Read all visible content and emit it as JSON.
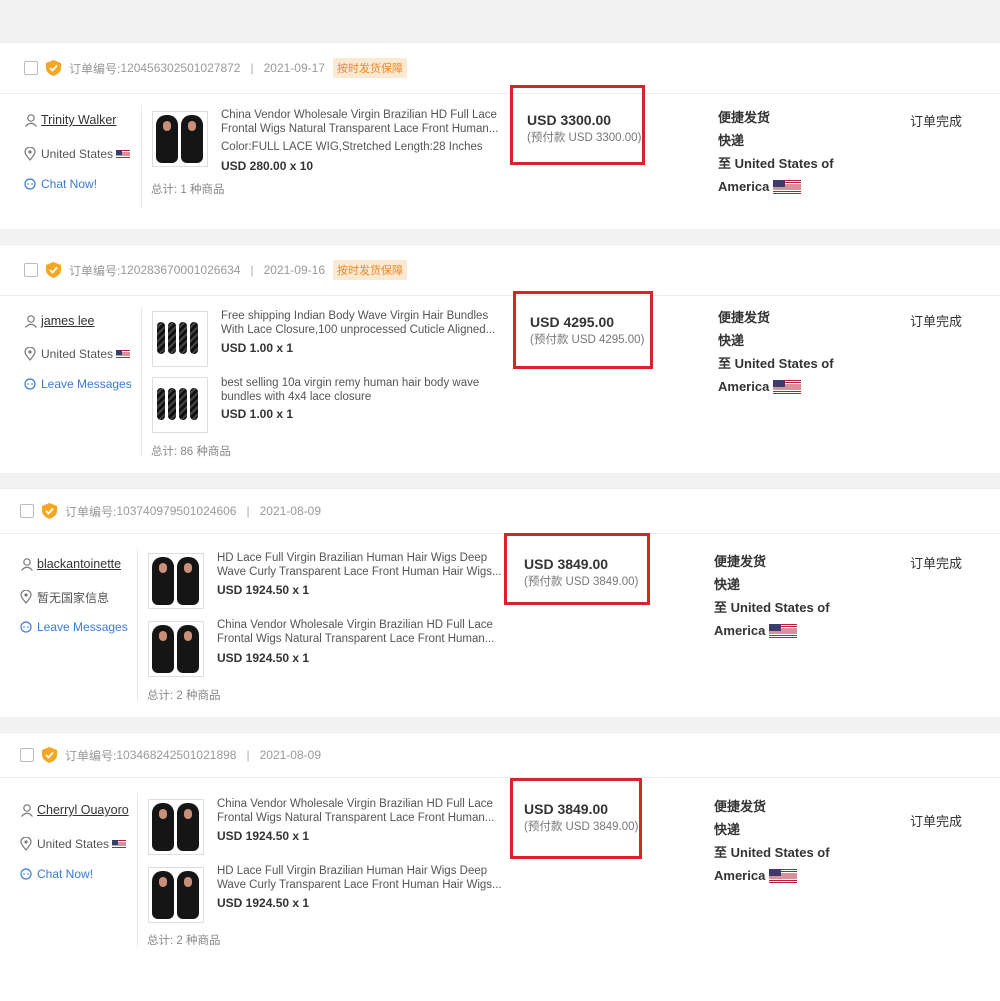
{
  "orders": [
    {
      "order_label": "订单编号:",
      "order_no": "120456302501027872",
      "date": "2021-09-17",
      "badge": "按时发货保障",
      "buyer": {
        "name": "Trinity Walker",
        "location": "United States",
        "contact": "Chat Now!"
      },
      "items": [
        {
          "title_line1": "China Vendor Wholesale Virgin Brazilian HD Full Lace",
          "title_line2": "Frontal Wigs Natural Transparent Lace Front Human...",
          "variant": "Color:FULL LACE WIG,Stretched Length:28 Inches",
          "unit": "USD 280.00 x 10",
          "image": "lace-wig-photo"
        }
      ],
      "total": "总计: 1 种商品",
      "price": "USD 3300.00",
      "prepay": "(预付款 USD 3300.00)",
      "shipping": {
        "method": "便捷发货",
        "type": "快递",
        "dest_line1": "至 United States of",
        "dest_line2": "America"
      },
      "status": "订单完成"
    },
    {
      "order_label": "订单编号:",
      "order_no": "120283670001026634",
      "date": "2021-09-16",
      "badge": "按时发货保障",
      "buyer": {
        "name": "james lee",
        "location": "United States",
        "contact": "Leave Messages"
      },
      "items": [
        {
          "title_line1": "Free shipping Indian Body Wave Virgin Hair Bundles",
          "title_line2": "With Lace Closure,100 unprocessed Cuticle Aligned...",
          "unit": "USD 1.00 x 1",
          "image": "hair-bundles-photo"
        },
        {
          "title_line1": "best selling 10a virgin remy human hair body wave",
          "title_line2": "bundles with 4x4 lace closure",
          "unit": "USD 1.00 x 1",
          "image": "hair-bundles-photo"
        }
      ],
      "total": "总计: 86 种商品",
      "price": "USD 4295.00",
      "prepay": "(预付款 USD 4295.00)",
      "shipping": {
        "method": "便捷发货",
        "type": "快递",
        "dest_line1": "至 United States of",
        "dest_line2": "America"
      },
      "status": "订单完成"
    },
    {
      "order_label": "订单编号:",
      "order_no": "103740979501024606",
      "date": "2021-08-09",
      "buyer": {
        "name": "blackantoinette",
        "location": "暂无国家信息",
        "contact": "Leave Messages"
      },
      "items": [
        {
          "title_line1": "HD Lace Full Virgin Brazilian Human Hair Wigs Deep",
          "title_line2": "Wave Curly Transparent Lace Front Human Hair Wigs...",
          "unit": "USD 1924.50 x 1",
          "image": "curly-wig-photo"
        },
        {
          "title_line1": "China Vendor Wholesale Virgin Brazilian HD Full Lace",
          "title_line2": "Frontal Wigs Natural Transparent Lace Front Human...",
          "unit": "USD 1924.50 x 1",
          "image": "lace-wig-photo"
        }
      ],
      "total": "总计: 2 种商品",
      "price": "USD 3849.00",
      "prepay": "(预付款 USD 3849.00)",
      "shipping": {
        "method": "便捷发货",
        "type": "快递",
        "dest_line1": "至 United States of",
        "dest_line2": "America"
      },
      "status": "订单完成"
    },
    {
      "order_label": "订单编号:",
      "order_no": "103468242501021898",
      "date": "2021-08-09",
      "buyer": {
        "name": "Cherryl Ouayoro",
        "location": "United States",
        "contact": "Chat Now!"
      },
      "items": [
        {
          "title_line1": "China Vendor Wholesale Virgin Brazilian HD Full Lace",
          "title_line2": "Frontal Wigs Natural Transparent Lace Front Human...",
          "unit": "USD 1924.50 x 1",
          "image": "lace-wig-photo"
        },
        {
          "title_line1": "HD Lace Full Virgin Brazilian Human Hair Wigs Deep",
          "title_line2": "Wave Curly Transparent Lace Front Human Hair Wigs...",
          "unit": "USD 1924.50 x 1",
          "image": "curly-wig-photo"
        }
      ],
      "total": "总计: 2 种商品",
      "price": "USD 3849.00",
      "prepay": "(预付款 USD 3849.00)",
      "shipping": {
        "method": "便捷发货",
        "type": "快递",
        "dest_line1": "至 United States of",
        "dest_line2": "America"
      },
      "status": "订单完成"
    }
  ],
  "colors": {
    "highlight_border": "#d9232a",
    "badge_bg": "#fbe9d2",
    "badge_text": "#e98a2d",
    "chat_link": "#3a7bd5"
  }
}
